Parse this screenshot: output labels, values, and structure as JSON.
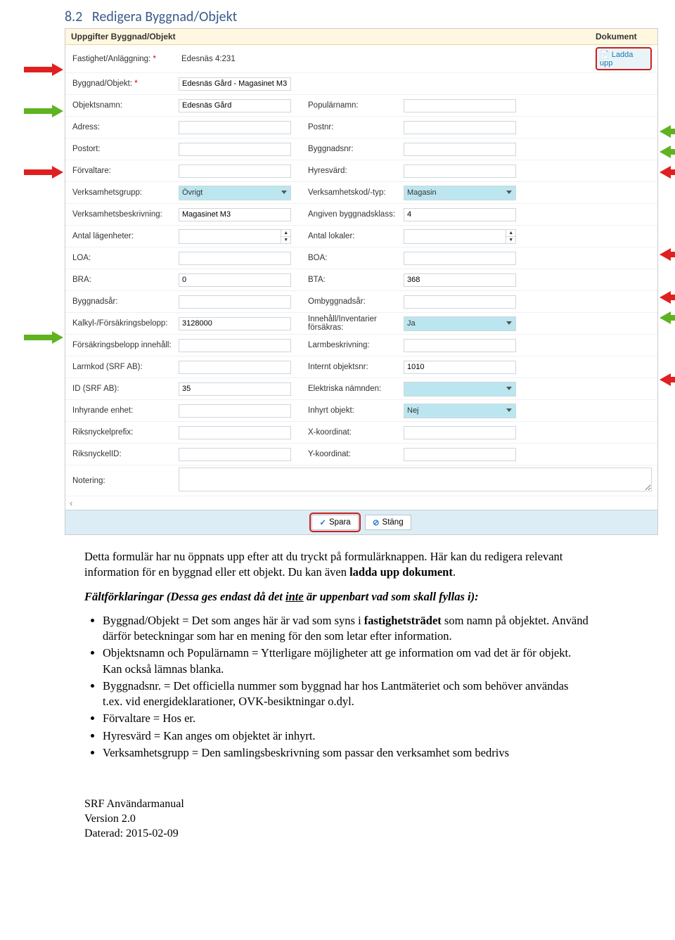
{
  "section": {
    "number": "8.2",
    "title": "Redigera Byggnad/Objekt"
  },
  "header": {
    "left": "Uppgifter Byggnad/Objekt",
    "right": "Dokument"
  },
  "labels": {
    "fastighet": "Fastighet/Anläggning:",
    "byggnad": "Byggnad/Objekt:",
    "objektsnamn": "Objektsnamn:",
    "popnamn": "Populärnamn:",
    "adress": "Adress:",
    "postnr": "Postnr:",
    "postort": "Postort:",
    "byggnadsnr": "Byggnadsnr:",
    "forvaltare": "Förvaltare:",
    "hyresvard": "Hyresvärd:",
    "verkGrupp": "Verksamhetsgrupp:",
    "verkKod": "Verksamhetskod/-typ:",
    "verkBeskr": "Verksamhetsbeskrivning:",
    "angivenKlass": "Angiven byggnadsklass:",
    "antalLag": "Antal lägenheter:",
    "antalLok": "Antal lokaler:",
    "loa": "LOA:",
    "boa": "BOA:",
    "bra": "BRA:",
    "bta": "BTA:",
    "byggar": "Byggnadsår:",
    "ombyggar": "Ombyggnadsår:",
    "kalkyl": "Kalkyl-/Försäkringsbelopp:",
    "innehall": "Innehåll/Inventarier försäkras:",
    "forsInneh": "Försäkringsbelopp innehåll:",
    "larmbeskr": "Larmbeskrivning:",
    "larmkod": "Larmkod (SRF AB):",
    "interntObj": "Internt objektsnr:",
    "idSrf": "ID (SRF AB):",
    "elektr": "Elektriska nämnden:",
    "inhyr": "Inhyrande enhet:",
    "inhyrtObj": "Inhyrt objekt:",
    "rikpref": "Riksnyckelprefix:",
    "xkoord": "X-koordinat:",
    "riksid": "RiksnyckelID:",
    "ykoord": "Y-koordinat:",
    "notering": "Notering:"
  },
  "required": "*",
  "values": {
    "fastighet": "Edesnäs 4:231",
    "byggnad": "Edesnäs Gård - Magasinet M3",
    "objektsnamn": "Edesnäs Gård",
    "verkGrupp": "Övrigt",
    "verkKod": "Magasin",
    "verkBeskr": "Magasinet M3",
    "angivenKlass": "4",
    "bra": "0",
    "bta": "368",
    "kalkyl": "3128000",
    "innehall": "Ja",
    "interntObj": "1010",
    "idSrf": "35",
    "inhyrtObj": "Nej"
  },
  "buttons": {
    "upload": "Ladda upp",
    "save": "Spara",
    "close": "Stäng"
  },
  "body": {
    "p1a": "Detta formulär har nu öppnats upp efter att du tryckt på formulärknappen. Här kan du redigera relevant information för en byggnad eller ett objekt. Du kan även ",
    "p1b": "ladda upp dokument",
    "p1c": ".",
    "p2a": "Fältförklaringar (Dessa ges endast då det ",
    "p2u": "inte",
    "p2b": " är uppenbart vad som skall fyllas i):",
    "b1a": "Byggnad/Objekt = Det som anges här är vad som syns i ",
    "b1b": "fastighetsträdet",
    "b1c": " som namn på objektet. Använd därför beteckningar som har en mening för den som letar efter information.",
    "b2": "Objektsnamn och Populärnamn = Ytterligare möjligheter att ge information om vad det är för objekt. Kan också lämnas blanka.",
    "b3": "Byggnadsnr. = Det officiella nummer som byggnad har hos Lantmäteriet och som behöver användas t.ex. vid energideklarationer, OVK-besiktningar o.dyl.",
    "b4": "Förvaltare = Hos er.",
    "b5": "Hyresvärd = Kan anges om objektet är inhyrt.",
    "b6": "Verksamhetsgrupp = Den samlingsbeskrivning som passar den verksamhet som bedrivs"
  },
  "footer": {
    "l1": "SRF Användarmanual",
    "l2": "Version 2.0",
    "l3": "Daterad: 2015-02-09"
  }
}
